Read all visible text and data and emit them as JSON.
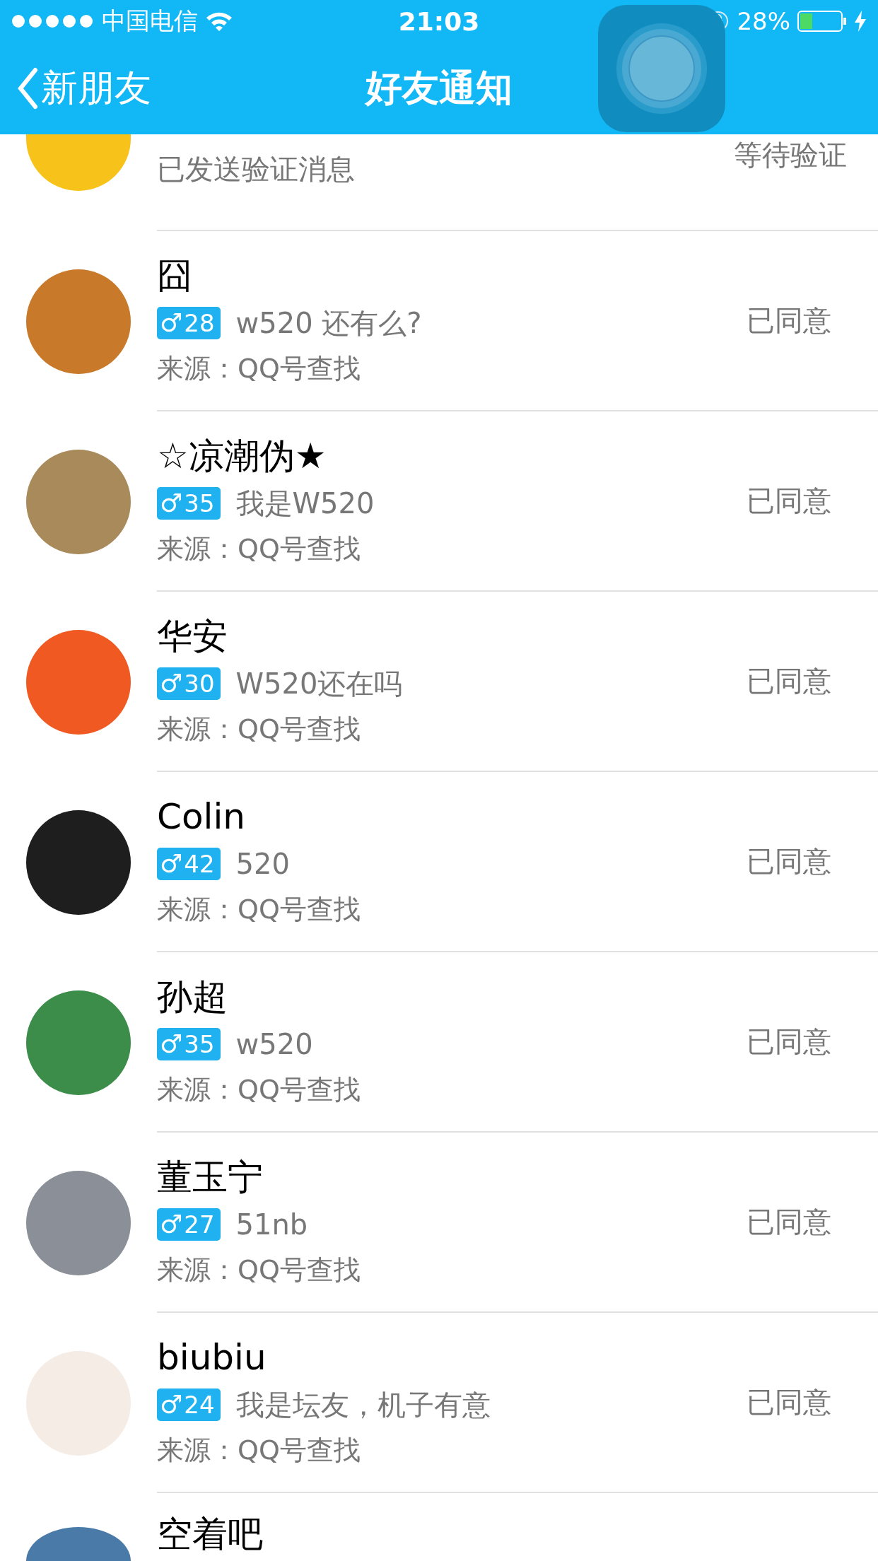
{
  "status_bar": {
    "carrier": "中国电信",
    "time": "21:03",
    "battery": "28%"
  },
  "nav": {
    "back": "新朋友",
    "title": "好友通知"
  },
  "requests": [
    {
      "kind": "pending",
      "message": "已发送验证消息",
      "status": "等待验证"
    },
    {
      "kind": "accepted",
      "name": "囧",
      "gender_symbol": "♂",
      "age": "28",
      "message": "w520 还有么?",
      "source": "来源：QQ号查找",
      "status": "已同意"
    },
    {
      "kind": "accepted",
      "name": "☆凉潮伪★",
      "gender_symbol": "♂",
      "age": "35",
      "message": "我是W520",
      "source": "来源：QQ号查找",
      "status": "已同意"
    },
    {
      "kind": "accepted",
      "name": "华安",
      "gender_symbol": "♂",
      "age": "30",
      "message": "W520还在吗",
      "source": "来源：QQ号查找",
      "status": "已同意"
    },
    {
      "kind": "accepted",
      "name": "Colin",
      "gender_symbol": "♂",
      "age": "42",
      "message": "520",
      "source": "来源：QQ号查找",
      "status": "已同意"
    },
    {
      "kind": "accepted",
      "name": "孙超",
      "gender_symbol": "♂",
      "age": "35",
      "message": "w520",
      "source": "来源：QQ号查找",
      "status": "已同意"
    },
    {
      "kind": "accepted",
      "name": "董玉宁",
      "gender_symbol": "♂",
      "age": "27",
      "message": "51nb",
      "source": "来源：QQ号查找",
      "status": "已同意"
    },
    {
      "kind": "accepted",
      "name": "biubiu",
      "gender_symbol": "♂",
      "age": "24",
      "message": "我是坛友，机子有意",
      "source": "来源：QQ号查找",
      "status": "已同意"
    },
    {
      "kind": "partial",
      "name": "空着吧"
    }
  ]
}
